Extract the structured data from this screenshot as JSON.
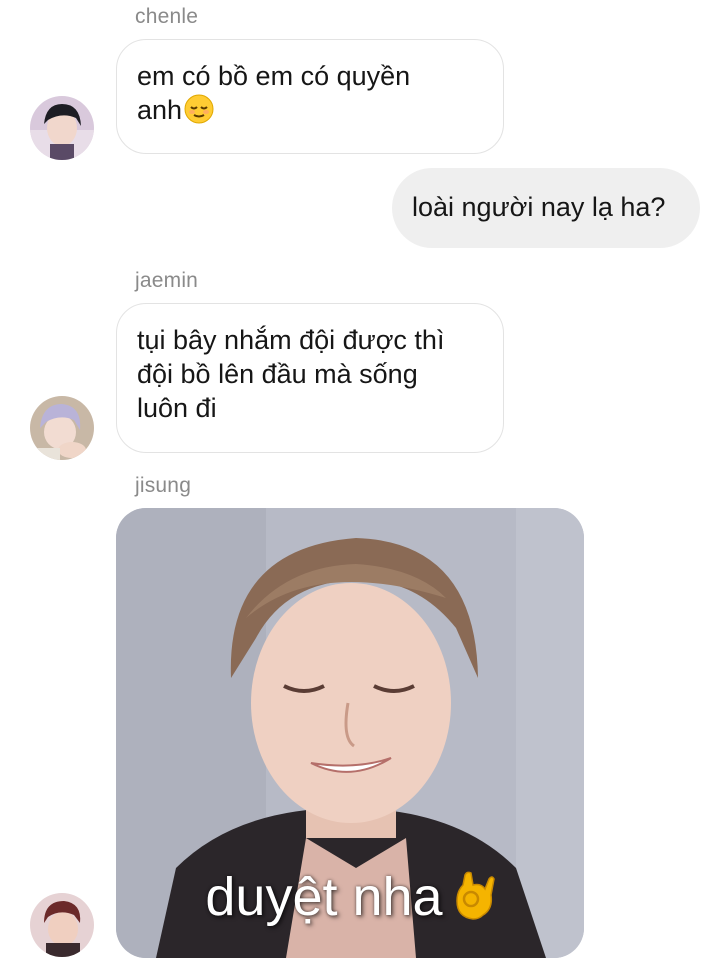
{
  "messages": [
    {
      "sender": "chenle",
      "text_line1": "em có bồ em có quyền",
      "text_line2": "anh",
      "emoji": "😌",
      "emoji_icon": "relieved-face-icon"
    },
    {
      "outgoing_text": "loài người nay lạ ha?"
    },
    {
      "sender": "jaemin",
      "lines": [
        "tụi bây nhắm đội được thì",
        "đội bồ lên đầu mà sống",
        "luôn đi"
      ]
    },
    {
      "sender": "jisung",
      "sticker_caption": "duyệt nha",
      "sticker_emoji_icon": "ok-hand-icon"
    }
  ],
  "colors": {
    "sender_name": "#8a8a8a",
    "incoming_bubble_border": "#e3e3e3",
    "outgoing_bubble_bg": "#efefef",
    "ok_hand": "#f5b400"
  }
}
